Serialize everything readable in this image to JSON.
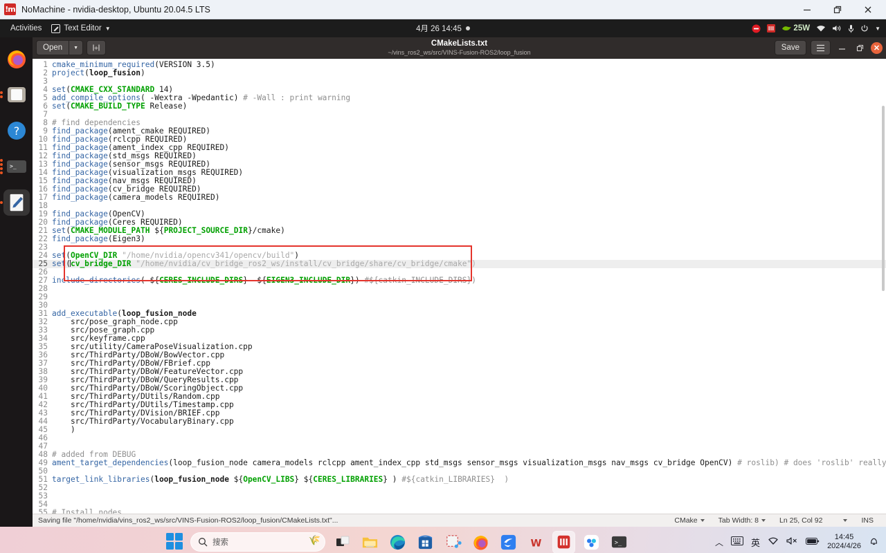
{
  "nomachine": {
    "logo": "nomachine-logo-icon",
    "title": "NoMachine - nvidia-desktop, Ubuntu 20.04.5 LTS",
    "minimize": "minimize-icon",
    "restore": "restore-icon",
    "close": "close-icon"
  },
  "gnome_topbar": {
    "activities": "Activities",
    "app_menu": "Text Editor",
    "clock": "4月 26  14:45",
    "tray": {
      "power_watts": "25W",
      "icons": [
        "do-not-disturb-icon",
        "nomachine-tray-icon",
        "nvidia-icon",
        "wifi-icon",
        "volume-icon",
        "microphone-icon",
        "power-icon",
        "chevron-down-icon"
      ]
    }
  },
  "dock": {
    "items": [
      {
        "name": "firefox",
        "label": "Firefox",
        "running": false,
        "dots": 0
      },
      {
        "name": "files",
        "label": "Files",
        "running": true,
        "dots": 2
      },
      {
        "name": "help",
        "label": "Help",
        "running": false,
        "dots": 0
      },
      {
        "name": "terminal",
        "label": "Terminal",
        "running": true,
        "dots": 4
      },
      {
        "name": "text-editor",
        "label": "Text Editor",
        "running": true,
        "dots": 1
      }
    ]
  },
  "editor": {
    "open_label": "Open",
    "open_dropdown": "chevron-down-icon",
    "new_tab_icon": "new-document-icon",
    "title": "CMakeLists.txt",
    "subtitle": "~/vins_ros2_ws/src/VINS-Fusion-ROS2/loop_fusion",
    "save_label": "Save",
    "menu_icon": "hamburger-menu-icon",
    "minimize": "minimize-icon",
    "restore": "restore-icon",
    "close": "close-icon"
  },
  "statusbar": {
    "message": "Saving file \"/home/nvidia/vins_ros2_ws/src/VINS-Fusion-ROS2/loop_fusion/CMakeLists.txt\"...",
    "language": "CMake",
    "tab_width": "Tab Width: 8",
    "position": "Ln 25, Col 92",
    "insert_mode": "INS"
  },
  "code": {
    "current_line": 25,
    "highlight_box": {
      "from_line": 23,
      "to_line": 26,
      "color": "#e4342c"
    },
    "lines": [
      {
        "n": 1,
        "html": "<span class='fn'>cmake_minimum_required</span>(VERSION 3.5)"
      },
      {
        "n": 2,
        "html": "<span class='fn'>project</span>(<span class='bd'>loop_fusion</span>)"
      },
      {
        "n": 3,
        "html": ""
      },
      {
        "n": 4,
        "html": "<span class='fn'>set</span>(<span class='var'>CMAKE_CXX_STANDARD</span> 14)"
      },
      {
        "n": 5,
        "html": "<span class='fn'>add_compile_options</span>( -Wextra -Wpedantic) <span class='cm'># -Wall : print warning</span>"
      },
      {
        "n": 6,
        "html": "<span class='fn'>set</span>(<span class='var'>CMAKE_BUILD_TYPE</span> Release)"
      },
      {
        "n": 7,
        "html": ""
      },
      {
        "n": 8,
        "html": "<span class='cm'># find dependencies</span>"
      },
      {
        "n": 9,
        "html": "<span class='fn'>find_package</span>(ament_cmake REQUIRED)"
      },
      {
        "n": 10,
        "html": "<span class='fn'>find_package</span>(rclcpp REQUIRED)"
      },
      {
        "n": 11,
        "html": "<span class='fn'>find_package</span>(ament_index_cpp REQUIRED)"
      },
      {
        "n": 12,
        "html": "<span class='fn'>find_package</span>(std_msgs REQUIRED)"
      },
      {
        "n": 13,
        "html": "<span class='fn'>find_package</span>(sensor_msgs REQUIRED)"
      },
      {
        "n": 14,
        "html": "<span class='fn'>find_package</span>(visualization_msgs REQUIRED)"
      },
      {
        "n": 15,
        "html": "<span class='fn'>find_package</span>(nav_msgs REQUIRED)"
      },
      {
        "n": 16,
        "html": "<span class='fn'>find_package</span>(cv_bridge REQUIRED)"
      },
      {
        "n": 17,
        "html": "<span class='fn'>find_package</span>(camera_models REQUIRED)"
      },
      {
        "n": 18,
        "html": ""
      },
      {
        "n": 19,
        "html": "<span class='fn'>find_package</span>(OpenCV)"
      },
      {
        "n": 20,
        "html": "<span class='fn'>find_package</span>(Ceres REQUIRED)"
      },
      {
        "n": 21,
        "html": "<span class='fn'>set</span>(<span class='var'>CMAKE_MODULE_PATH</span> $&#123;<span class='var'>PROJECT_SOURCE_DIR</span>&#125;/cmake)"
      },
      {
        "n": 22,
        "html": "<span class='fn'>find_package</span>(Eigen3)"
      },
      {
        "n": 23,
        "html": ""
      },
      {
        "n": 24,
        "html": "<span class='fn'>set</span>(<span class='var'>OpenCV_DIR</span> <span class='st'>\"/home/nvidia/opencv341/opencv/build\"</span>)"
      },
      {
        "n": 25,
        "html": "<span class='fn'>set</span>(<span class='caret'></span><span class='var'>cv_bridge_DIR</span> <span class='st'>\"/home/nvidia/cv_bridge_ros2_ws/install/cv_bridge/share/cv_bridge/cmake\"</span><span class='st2'>)</span>"
      },
      {
        "n": 26,
        "html": ""
      },
      {
        "n": 27,
        "html": "<span class='fn'>include_directories</span>( $&#123;<span class='var'>CERES_INCLUDE_DIRS</span>&#125;  $&#123;<span class='var'>EIGEN3_INCLUDE_DIR</span>&#125;) <span class='cm'>#$&#123;catkin_INCLUDE_DIRS&#125;)</span>"
      },
      {
        "n": 28,
        "html": ""
      },
      {
        "n": 29,
        "html": ""
      },
      {
        "n": 30,
        "html": ""
      },
      {
        "n": 31,
        "html": "<span class='fn'>add_executable</span>(<span class='bd'>loop_fusion_node</span>"
      },
      {
        "n": 32,
        "html": "    src/pose_graph_node.cpp"
      },
      {
        "n": 33,
        "html": "    src/pose_graph.cpp"
      },
      {
        "n": 34,
        "html": "    src/keyframe.cpp"
      },
      {
        "n": 35,
        "html": "    src/utility/CameraPoseVisualization.cpp"
      },
      {
        "n": 36,
        "html": "    src/ThirdParty/DBoW/BowVector.cpp"
      },
      {
        "n": 37,
        "html": "    src/ThirdParty/DBoW/FBrief.cpp"
      },
      {
        "n": 38,
        "html": "    src/ThirdParty/DBoW/FeatureVector.cpp"
      },
      {
        "n": 39,
        "html": "    src/ThirdParty/DBoW/QueryResults.cpp"
      },
      {
        "n": 40,
        "html": "    src/ThirdParty/DBoW/ScoringObject.cpp"
      },
      {
        "n": 41,
        "html": "    src/ThirdParty/DUtils/Random.cpp"
      },
      {
        "n": 42,
        "html": "    src/ThirdParty/DUtils/Timestamp.cpp"
      },
      {
        "n": 43,
        "html": "    src/ThirdParty/DVision/BRIEF.cpp"
      },
      {
        "n": 44,
        "html": "    src/ThirdParty/VocabularyBinary.cpp"
      },
      {
        "n": 45,
        "html": "    )"
      },
      {
        "n": 46,
        "html": ""
      },
      {
        "n": 47,
        "html": ""
      },
      {
        "n": 48,
        "html": "<span class='cm'># added from DEBUG</span>"
      },
      {
        "n": 49,
        "html": "<span class='fn'>ament_target_dependencies</span>(loop_fusion_node camera_models rclcpp ament_index_cpp std_msgs sensor_msgs visualization_msgs nav_msgs cv_bridge OpenCV) <span class='cm'># roslib) # does 'roslib' really need ??</span>"
      },
      {
        "n": 50,
        "html": ""
      },
      {
        "n": 51,
        "html": "<span class='fn'>target_link_libraries</span>(<span class='bd'>loop_fusion_node</span> $&#123;<span class='var'>OpenCV_LIBS</span>&#125; $&#123;<span class='var'>CERES_LIBRARIES</span>&#125; ) <span class='cm'>#$&#123;catkin_LIBRARIES&#125;  )</span>"
      },
      {
        "n": 52,
        "html": ""
      },
      {
        "n": 53,
        "html": ""
      },
      {
        "n": 54,
        "html": ""
      },
      {
        "n": 55,
        "html": "<span class='cm'># Install nodes</span>"
      }
    ]
  },
  "taskbar": {
    "start": "windows-start-icon",
    "search_placeholder": "搜索",
    "apps": [
      {
        "name": "task-view",
        "running": false
      },
      {
        "name": "file-explorer",
        "running": true
      },
      {
        "name": "microsoft-edge",
        "running": true
      },
      {
        "name": "microsoft-store",
        "running": false
      },
      {
        "name": "snipping-tool",
        "running": true
      },
      {
        "name": "firefox",
        "running": true
      },
      {
        "name": "blue-bird-app",
        "running": false
      },
      {
        "name": "wps-office",
        "running": true
      },
      {
        "name": "nomachine",
        "running": true,
        "active": true
      },
      {
        "name": "baidu-netdisk",
        "running": true
      },
      {
        "name": "windows-terminal",
        "running": true
      }
    ],
    "tray": {
      "overflow": "chevron-up-icon",
      "keyboard": "keyboard-icon",
      "ime": "英",
      "wifi": "wifi-icon",
      "volume": "volume-muted-icon",
      "battery": "battery-icon",
      "time": "14:45",
      "date": "2024/4/26",
      "notifications": "bell-icon"
    }
  }
}
